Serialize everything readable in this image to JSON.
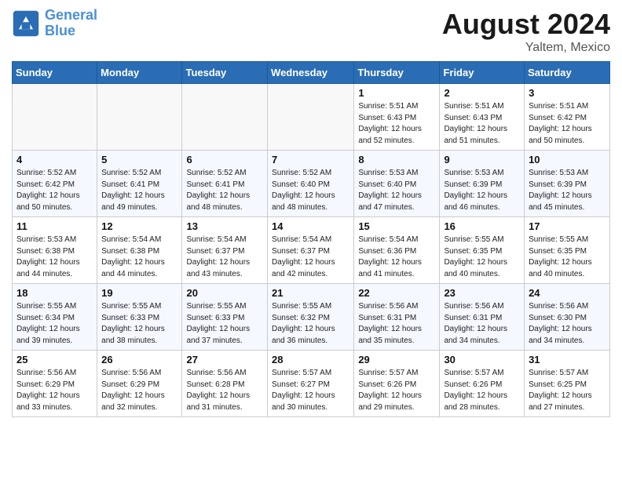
{
  "header": {
    "logo_line1": "General",
    "logo_line2": "Blue",
    "month_year": "August 2024",
    "location": "Yaltem, Mexico"
  },
  "weekdays": [
    "Sunday",
    "Monday",
    "Tuesday",
    "Wednesday",
    "Thursday",
    "Friday",
    "Saturday"
  ],
  "weeks": [
    [
      {
        "day": null,
        "info": null
      },
      {
        "day": null,
        "info": null
      },
      {
        "day": null,
        "info": null
      },
      {
        "day": null,
        "info": null
      },
      {
        "day": "1",
        "info": "Sunrise: 5:51 AM\nSunset: 6:43 PM\nDaylight: 12 hours\nand 52 minutes."
      },
      {
        "day": "2",
        "info": "Sunrise: 5:51 AM\nSunset: 6:43 PM\nDaylight: 12 hours\nand 51 minutes."
      },
      {
        "day": "3",
        "info": "Sunrise: 5:51 AM\nSunset: 6:42 PM\nDaylight: 12 hours\nand 50 minutes."
      }
    ],
    [
      {
        "day": "4",
        "info": "Sunrise: 5:52 AM\nSunset: 6:42 PM\nDaylight: 12 hours\nand 50 minutes."
      },
      {
        "day": "5",
        "info": "Sunrise: 5:52 AM\nSunset: 6:41 PM\nDaylight: 12 hours\nand 49 minutes."
      },
      {
        "day": "6",
        "info": "Sunrise: 5:52 AM\nSunset: 6:41 PM\nDaylight: 12 hours\nand 48 minutes."
      },
      {
        "day": "7",
        "info": "Sunrise: 5:52 AM\nSunset: 6:40 PM\nDaylight: 12 hours\nand 48 minutes."
      },
      {
        "day": "8",
        "info": "Sunrise: 5:53 AM\nSunset: 6:40 PM\nDaylight: 12 hours\nand 47 minutes."
      },
      {
        "day": "9",
        "info": "Sunrise: 5:53 AM\nSunset: 6:39 PM\nDaylight: 12 hours\nand 46 minutes."
      },
      {
        "day": "10",
        "info": "Sunrise: 5:53 AM\nSunset: 6:39 PM\nDaylight: 12 hours\nand 45 minutes."
      }
    ],
    [
      {
        "day": "11",
        "info": "Sunrise: 5:53 AM\nSunset: 6:38 PM\nDaylight: 12 hours\nand 44 minutes."
      },
      {
        "day": "12",
        "info": "Sunrise: 5:54 AM\nSunset: 6:38 PM\nDaylight: 12 hours\nand 44 minutes."
      },
      {
        "day": "13",
        "info": "Sunrise: 5:54 AM\nSunset: 6:37 PM\nDaylight: 12 hours\nand 43 minutes."
      },
      {
        "day": "14",
        "info": "Sunrise: 5:54 AM\nSunset: 6:37 PM\nDaylight: 12 hours\nand 42 minutes."
      },
      {
        "day": "15",
        "info": "Sunrise: 5:54 AM\nSunset: 6:36 PM\nDaylight: 12 hours\nand 41 minutes."
      },
      {
        "day": "16",
        "info": "Sunrise: 5:55 AM\nSunset: 6:35 PM\nDaylight: 12 hours\nand 40 minutes."
      },
      {
        "day": "17",
        "info": "Sunrise: 5:55 AM\nSunset: 6:35 PM\nDaylight: 12 hours\nand 40 minutes."
      }
    ],
    [
      {
        "day": "18",
        "info": "Sunrise: 5:55 AM\nSunset: 6:34 PM\nDaylight: 12 hours\nand 39 minutes."
      },
      {
        "day": "19",
        "info": "Sunrise: 5:55 AM\nSunset: 6:33 PM\nDaylight: 12 hours\nand 38 minutes."
      },
      {
        "day": "20",
        "info": "Sunrise: 5:55 AM\nSunset: 6:33 PM\nDaylight: 12 hours\nand 37 minutes."
      },
      {
        "day": "21",
        "info": "Sunrise: 5:55 AM\nSunset: 6:32 PM\nDaylight: 12 hours\nand 36 minutes."
      },
      {
        "day": "22",
        "info": "Sunrise: 5:56 AM\nSunset: 6:31 PM\nDaylight: 12 hours\nand 35 minutes."
      },
      {
        "day": "23",
        "info": "Sunrise: 5:56 AM\nSunset: 6:31 PM\nDaylight: 12 hours\nand 34 minutes."
      },
      {
        "day": "24",
        "info": "Sunrise: 5:56 AM\nSunset: 6:30 PM\nDaylight: 12 hours\nand 34 minutes."
      }
    ],
    [
      {
        "day": "25",
        "info": "Sunrise: 5:56 AM\nSunset: 6:29 PM\nDaylight: 12 hours\nand 33 minutes."
      },
      {
        "day": "26",
        "info": "Sunrise: 5:56 AM\nSunset: 6:29 PM\nDaylight: 12 hours\nand 32 minutes."
      },
      {
        "day": "27",
        "info": "Sunrise: 5:56 AM\nSunset: 6:28 PM\nDaylight: 12 hours\nand 31 minutes."
      },
      {
        "day": "28",
        "info": "Sunrise: 5:57 AM\nSunset: 6:27 PM\nDaylight: 12 hours\nand 30 minutes."
      },
      {
        "day": "29",
        "info": "Sunrise: 5:57 AM\nSunset: 6:26 PM\nDaylight: 12 hours\nand 29 minutes."
      },
      {
        "day": "30",
        "info": "Sunrise: 5:57 AM\nSunset: 6:26 PM\nDaylight: 12 hours\nand 28 minutes."
      },
      {
        "day": "31",
        "info": "Sunrise: 5:57 AM\nSunset: 6:25 PM\nDaylight: 12 hours\nand 27 minutes."
      }
    ]
  ]
}
